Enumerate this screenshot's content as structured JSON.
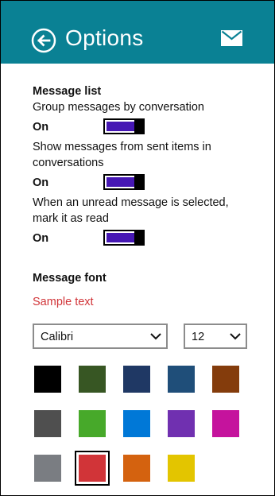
{
  "header": {
    "title": "Options",
    "bg_color": "#0a8194"
  },
  "message_list": {
    "heading": "Message list",
    "settings": [
      {
        "description": "Group messages by conversation",
        "state": "On"
      },
      {
        "description": "Show messages from sent items in conversations",
        "state": "On"
      },
      {
        "description": "When an unread message is selected, mark it as read",
        "state": "On"
      }
    ],
    "toggle_color": "#4617b4"
  },
  "message_font": {
    "heading": "Message font",
    "sample_text": "Sample text",
    "sample_color": "#d13438",
    "font_family": {
      "selected": "Calibri"
    },
    "font_size": {
      "selected": "12"
    },
    "colors": [
      "#000000",
      "#375623",
      "#1f3864",
      "#1f4e79",
      "#843c0c",
      "#4f4f4f",
      "#47a92a",
      "#0078d7",
      "#7030b0",
      "#c5139d",
      "#7a7d82",
      "#d13438",
      "#d4620f",
      "#e3c500"
    ],
    "selected_color_index": 11
  }
}
